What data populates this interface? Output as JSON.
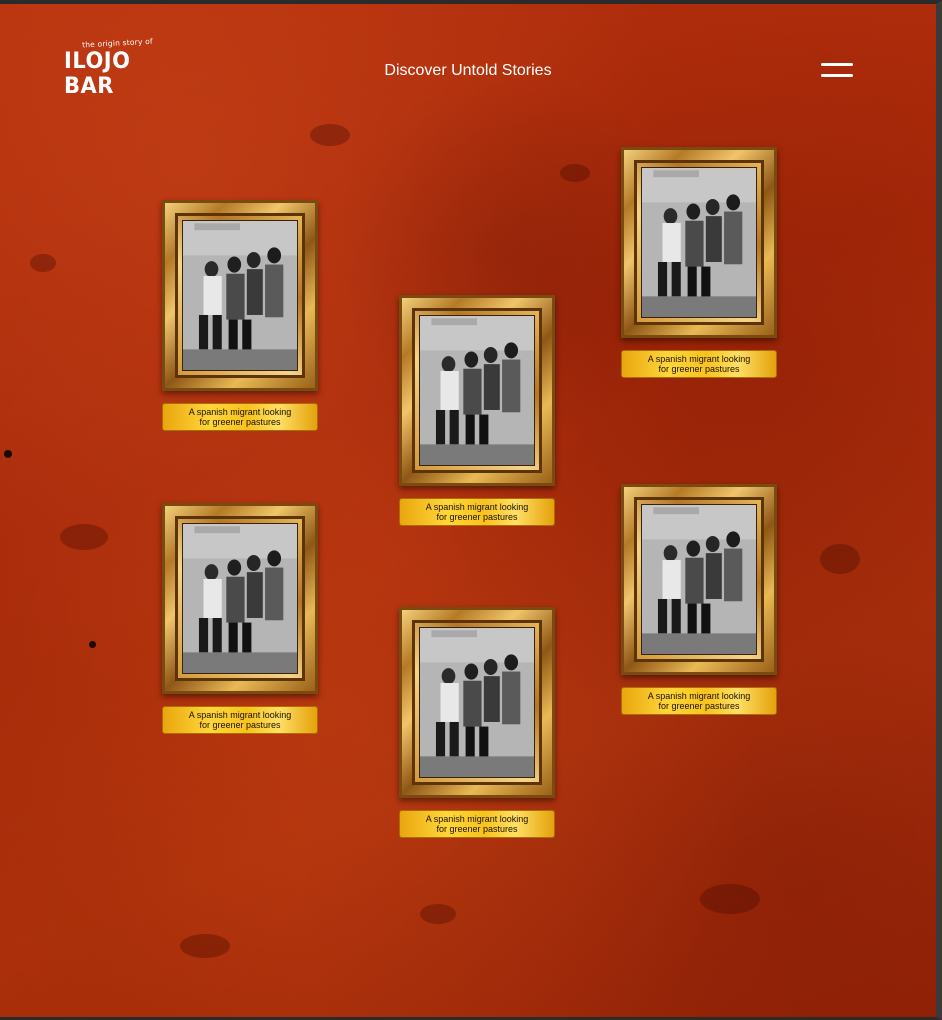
{
  "header": {
    "logo_tagline": "the origin story of",
    "logo_name": "ILOJO BAR",
    "nav_title": "Discover Untold Stories",
    "menu_icon": "hamburger-menu-icon"
  },
  "gallery": {
    "items": [
      {
        "caption_line1": "A spanish migrant looking",
        "caption_line2": "for greener pastures"
      },
      {
        "caption_line1": "A spanish migrant looking",
        "caption_line2": "for greener pastures"
      },
      {
        "caption_line1": "A spanish migrant looking",
        "caption_line2": "for greener pastures"
      },
      {
        "caption_line1": "A spanish migrant looking",
        "caption_line2": "for greener pastures"
      },
      {
        "caption_line1": "A spanish migrant looking",
        "caption_line2": "for greener pastures"
      },
      {
        "caption_line1": "A spanish migrant looking",
        "caption_line2": "for greener pastures"
      }
    ]
  },
  "colors": {
    "background": "#b4300c",
    "caption_gold": "#f7c21c",
    "frame_gold": "#d39a3c",
    "text_light": "#ffffff"
  }
}
